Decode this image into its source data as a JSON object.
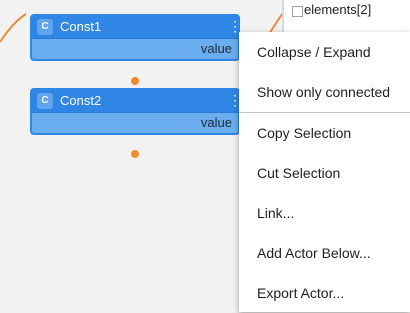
{
  "background_node": {
    "element_label": "elements[2]"
  },
  "nodes": [
    {
      "badge": "C",
      "title": "Const1",
      "output_label": "value"
    },
    {
      "badge": "C",
      "title": "Const2",
      "output_label": "value"
    }
  ],
  "context_menu": {
    "items": [
      "Collapse / Expand",
      "Show only connected",
      "Copy Selection",
      "Cut Selection",
      "Link...",
      "Add Actor Below...",
      "Export Actor..."
    ]
  },
  "colors": {
    "node_header": "#2f86e5",
    "node_body": "#6aaef0",
    "port_dot": "#f08a2c",
    "connector": "#f0883c",
    "green_accent": "#2e9d6f"
  }
}
